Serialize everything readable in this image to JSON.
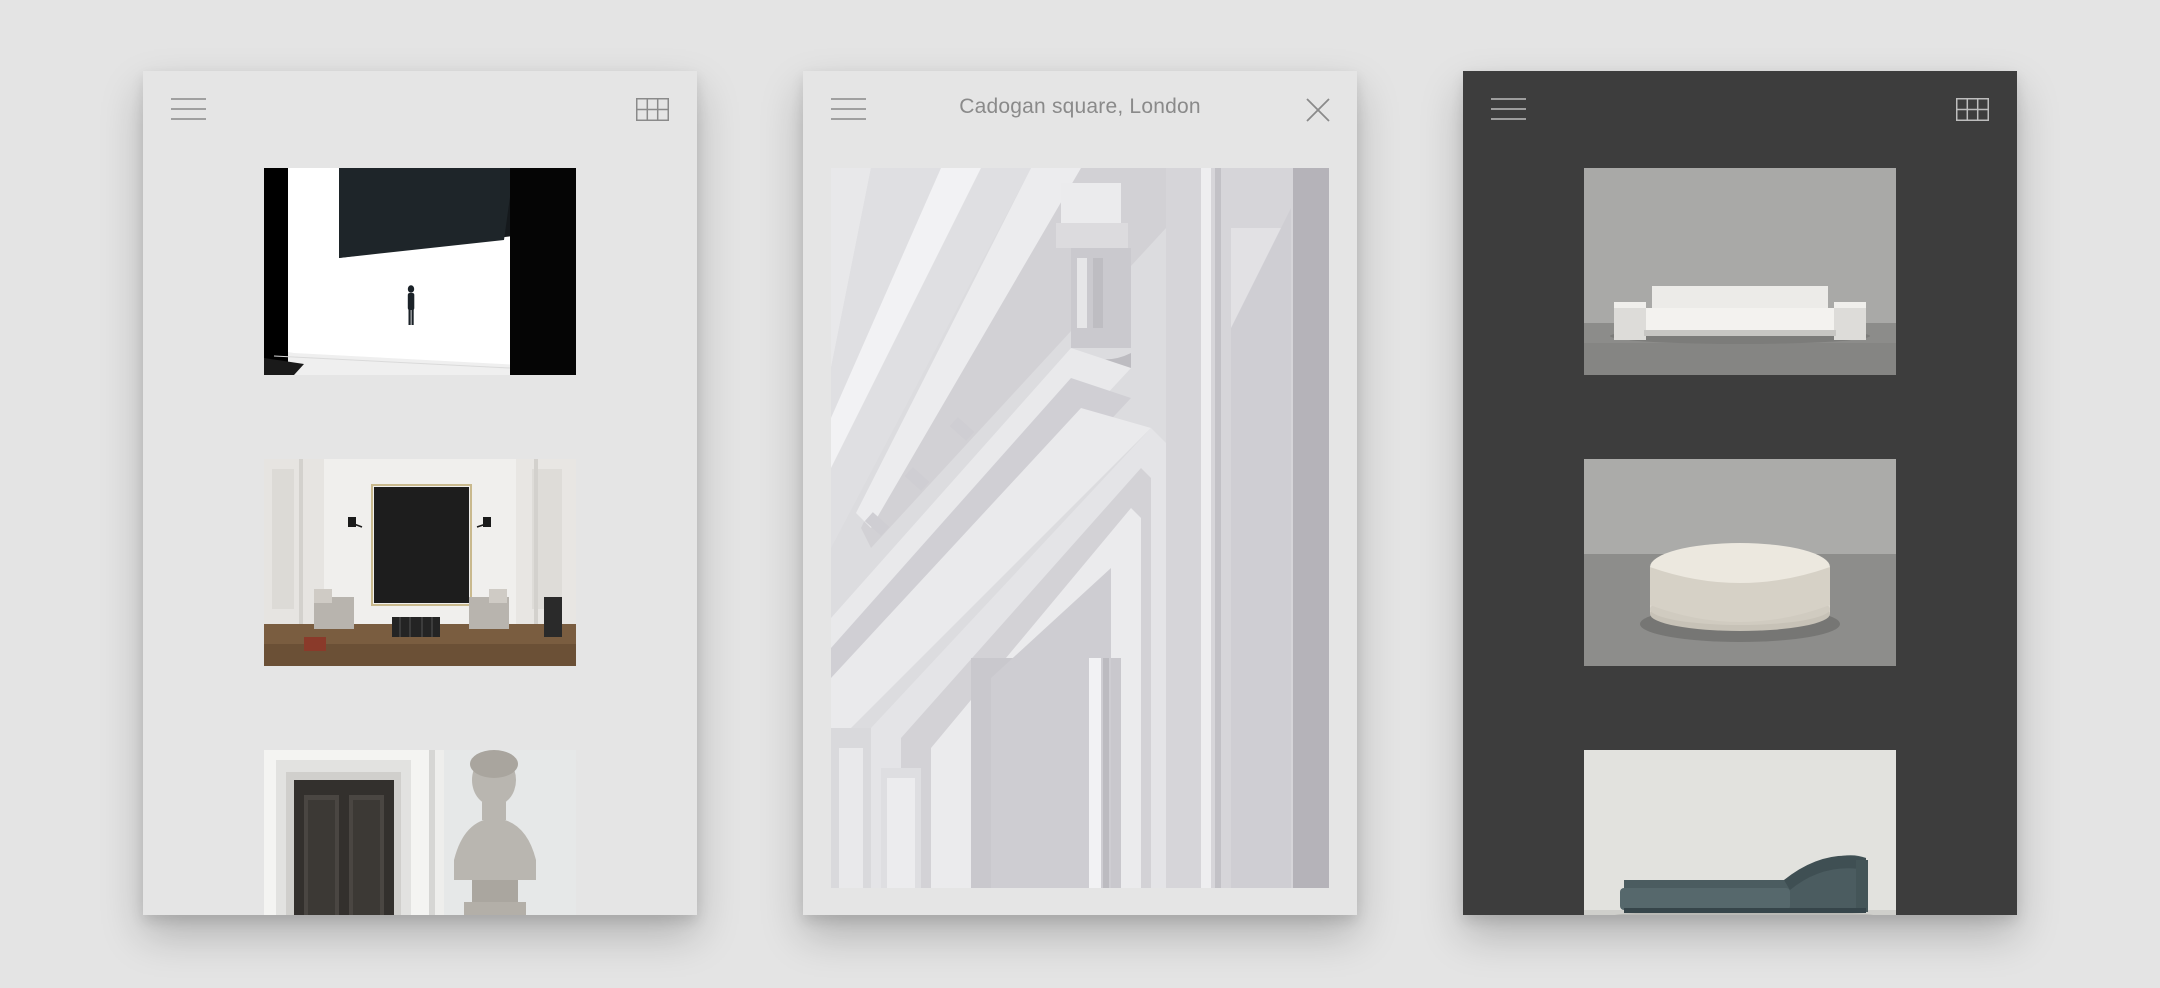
{
  "screens": [
    {
      "theme": "light",
      "header": {
        "menu_icon": "hamburger-menu-icon",
        "view_icon": "grid-view-icon"
      },
      "gallery": [
        {
          "subject": "gallery-figure-dark-room"
        },
        {
          "subject": "living-room-black-painting"
        },
        {
          "subject": "doorway-with-bust"
        }
      ]
    },
    {
      "theme": "light",
      "header": {
        "menu_icon": "hamburger-menu-icon",
        "title": "Cadogan square, London",
        "close_icon": "close-icon"
      },
      "hero": {
        "subject": "white-cornice-moulding"
      }
    },
    {
      "theme": "dark",
      "header": {
        "menu_icon": "hamburger-menu-icon",
        "view_icon": "grid-view-icon"
      },
      "gallery": [
        {
          "subject": "white-sofa"
        },
        {
          "subject": "round-stone-table"
        },
        {
          "subject": "green-daybed"
        }
      ]
    }
  ],
  "colors": {
    "background": "#e4e4e4",
    "panel_light": "#e5e5e5",
    "panel_dark": "#3d3d3d",
    "icon_light": "#8a8a8a",
    "icon_dark": "#bdbdbd",
    "title_text": "#8a8a8a"
  }
}
